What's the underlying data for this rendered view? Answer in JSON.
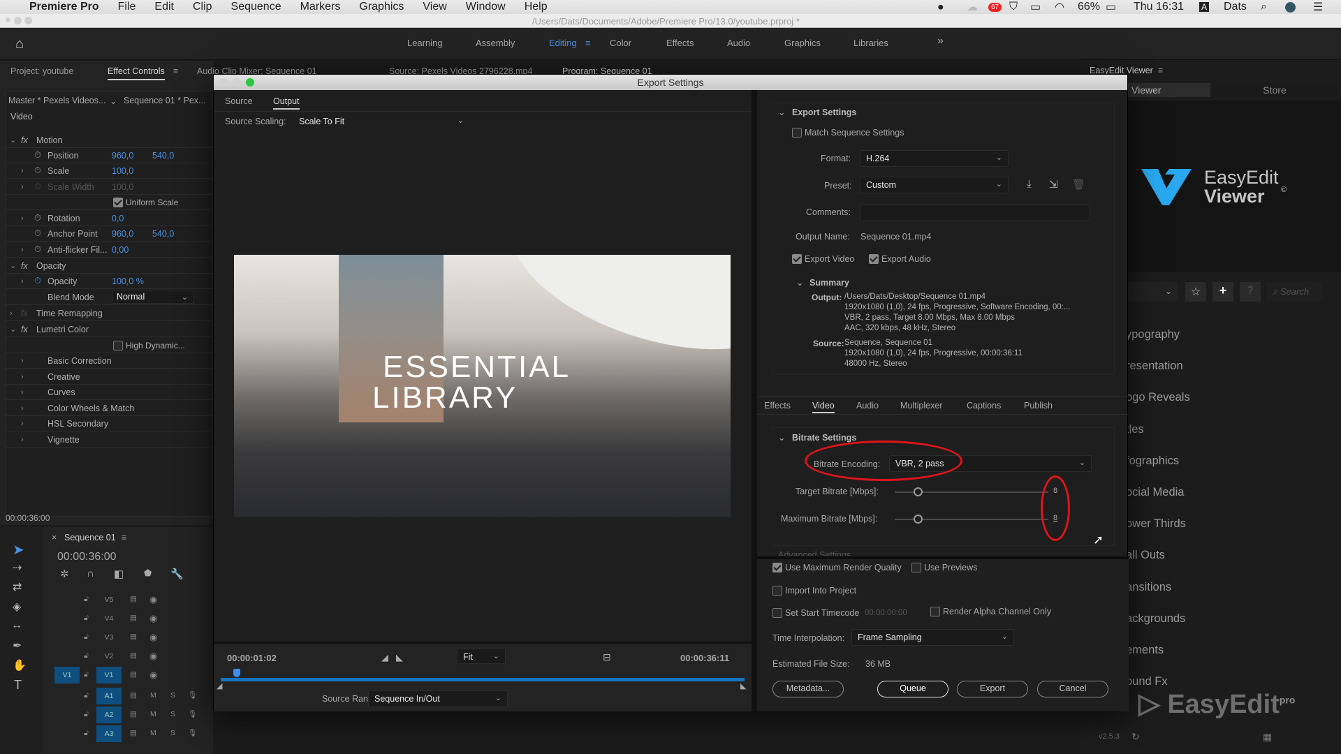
{
  "menubar": {
    "app": "Premiere Pro",
    "items": [
      "File",
      "Edit",
      "Clip",
      "Sequence",
      "Markers",
      "Graphics",
      "View",
      "Window",
      "Help"
    ],
    "battery": "66%",
    "clock": "Thu 16:31",
    "input_source": "A",
    "user": "Dats",
    "notification_badge": "67"
  },
  "window": {
    "path": "/Users/Dats/Documents/Adobe/Premiere Pro/13.0/youtube.prproj *"
  },
  "workspaces": {
    "items": [
      "Learning",
      "Assembly",
      "Editing",
      "Color",
      "Effects",
      "Audio",
      "Graphics",
      "Libraries"
    ],
    "active": "Editing",
    "overflow": "»"
  },
  "left_panel": {
    "tabs": [
      "Project: youtube",
      "Effect Controls",
      "Audio Clip Mixer: Sequence 01"
    ],
    "source_clip": "Master * Pexels Videos...",
    "sequence_clip": "Sequence 01 * Pex...",
    "section": "Video",
    "rows": [
      {
        "name": "Motion",
        "type": "fx"
      },
      {
        "name": "Position",
        "v1": "960,0",
        "v2": "540,0"
      },
      {
        "name": "Scale",
        "v1": "100,0"
      },
      {
        "name": "Scale Width",
        "v1": "100,0",
        "disabled": true
      },
      {
        "name": "Uniform Scale",
        "type": "checkbox",
        "checked": true
      },
      {
        "name": "Rotation",
        "v1": "0,0"
      },
      {
        "name": "Anchor Point",
        "v1": "960,0",
        "v2": "540,0"
      },
      {
        "name": "Anti-flicker Fil...",
        "v1": "0,00"
      },
      {
        "name": "Opacity",
        "type": "fx"
      },
      {
        "name": "Opacity",
        "v1": "100,0 %"
      },
      {
        "name": "Blend Mode",
        "dropdown": "Normal"
      },
      {
        "name": "Time Remapping",
        "type": "fx"
      },
      {
        "name": "Lumetri Color",
        "type": "fx"
      },
      {
        "name": "High Dynamic...",
        "type": "checkbox",
        "checked": false
      },
      {
        "name": "Basic Correction"
      },
      {
        "name": "Creative"
      },
      {
        "name": "Curves"
      },
      {
        "name": "Color Wheels & Match"
      },
      {
        "name": "HSL Secondary"
      },
      {
        "name": "Vignette"
      }
    ],
    "timecode": "00:00:36:00"
  },
  "timeline": {
    "title": "Sequence 01",
    "timecode": "00:00:36:00",
    "video_tracks": [
      "V5",
      "V4",
      "V3",
      "V2",
      "V1"
    ],
    "audio_tracks": [
      "A1",
      "A2",
      "A3"
    ],
    "source_patch": "V1",
    "mute_label": "M",
    "solo_label": "S"
  },
  "source_monitor": {
    "title": "Source: Pexels Videos 2796228.mp4"
  },
  "program_monitor": {
    "title": "Program: Sequence 01"
  },
  "export": {
    "title": "Export Settings",
    "tabs": [
      "Source",
      "Output"
    ],
    "active_tab": "Output",
    "source_scaling_label": "Source Scaling:",
    "source_scaling": "Scale To Fit",
    "preview_text_line1": "ESSENTIAL",
    "preview_text_line2": "LIBRARY",
    "current_time": "00:00:01:02",
    "duration": "00:00:36:11",
    "zoom": "Fit",
    "playhead_fraction": 0.03,
    "source_range_label": "Source Range:",
    "source_range": "Sequence In/Out",
    "settings": {
      "section": "Export Settings",
      "match_sequence": "Match Sequence Settings",
      "match_checked": false,
      "format_label": "Format:",
      "format": "H.264",
      "preset_label": "Preset:",
      "preset": "Custom",
      "comments_label": "Comments:",
      "comments": "",
      "output_name_label": "Output Name:",
      "output_name": "Sequence 01.mp4",
      "export_video": "Export Video",
      "export_audio": "Export Audio",
      "summary": "Summary",
      "output_label": "Output:",
      "output_lines": [
        "/Users/Dats/Desktop/Sequence 01.mp4",
        "1920x1080 (1,0), 24 fps, Progressive, Software Encoding, 00:...",
        "VBR, 2 pass, Target 8.00 Mbps, Max 8.00 Mbps",
        "AAC, 320 kbps, 48 kHz, Stereo"
      ],
      "source_label": "Source:",
      "source_lines": [
        "Sequence, Sequence 01",
        "1920x1080 (1,0), 24 fps, Progressive, 00:00:36:11",
        "48000 Hz, Stereo"
      ]
    },
    "sub_tabs": [
      "Effects",
      "Video",
      "Audio",
      "Multiplexer",
      "Captions",
      "Publish"
    ],
    "active_sub_tab": "Video",
    "bitrate": {
      "section": "Bitrate Settings",
      "encoding_label": "Bitrate Encoding:",
      "encoding": "VBR, 2 pass",
      "target_label": "Target Bitrate [Mbps]:",
      "target": "8",
      "max_label": "Maximum Bitrate [Mbps]:",
      "max": "8",
      "target_fraction": 0.15,
      "max_fraction": 0.15,
      "advanced": "Advanced Settings"
    },
    "options": {
      "max_render": "Use Maximum Render Quality",
      "use_previews": "Use Previews",
      "import_project": "Import Into Project",
      "start_timecode": "Set Start Timecode",
      "start_timecode_value": "00:00:00:00",
      "alpha_only": "Render Alpha Channel Only",
      "interp_label": "Time Interpolation:",
      "interp": "Frame Sampling",
      "filesize_label": "Estimated File Size:",
      "filesize": "36 MB"
    },
    "buttons": {
      "metadata": "Metadata...",
      "queue": "Queue",
      "export": "Export",
      "cancel": "Cancel"
    }
  },
  "easyedit": {
    "panel_title": "EasyEdit Viewer",
    "tabs": [
      "Viewer",
      "Store"
    ],
    "logo_line1": "EasyEdit",
    "logo_line2": "Viewer",
    "search_placeholder": "Search",
    "categories": [
      "ypography",
      "resentation",
      "ogo Reveals",
      "tles",
      "fographics",
      "ocial Media",
      "ower Thirds",
      "all Outs",
      "ansitions",
      "ackgrounds",
      "ements",
      "ound Fx"
    ],
    "version": "v2.5.3",
    "watermark": "EasyEdit",
    "watermark_sup": "pro",
    "accent": "#29a8f0"
  }
}
